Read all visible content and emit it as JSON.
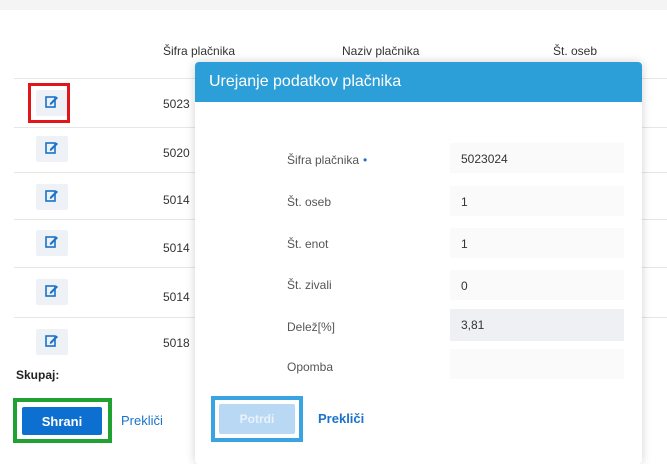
{
  "table": {
    "headers": [
      "Šifra plačnika",
      "Naziv plačnika",
      "Št. oseb"
    ],
    "rows": [
      {
        "code": "5023"
      },
      {
        "code": "5020"
      },
      {
        "code": "5014"
      },
      {
        "code": "5014"
      },
      {
        "code": "5014"
      },
      {
        "code": "5018"
      }
    ],
    "total_label": "Skupaj:"
  },
  "footer": {
    "save_label": "Shrani",
    "cancel_label": "Prekliči"
  },
  "modal": {
    "title": "Urejanje podatkov plačnika",
    "fields": [
      {
        "label": "Šifra plačnika",
        "required_mark": "•",
        "value": "5023024"
      },
      {
        "label": "Št. oseb",
        "value": "1"
      },
      {
        "label": "Št. enot",
        "value": "1"
      },
      {
        "label": "Št. zivali",
        "value": "0"
      },
      {
        "label": "Delež[%]",
        "value": "3,81"
      },
      {
        "label": "Opomba",
        "value": ""
      }
    ],
    "confirm_label": "Potrdi",
    "cancel_label": "Prekliči"
  },
  "colors": {
    "header": "#2d9fd8",
    "primary_button": "#0d6fcf",
    "highlight_red": "#e0161b",
    "highlight_green": "#20a233",
    "highlight_blue": "#3aa3e2"
  },
  "icons": {
    "edit": "edit-icon"
  }
}
